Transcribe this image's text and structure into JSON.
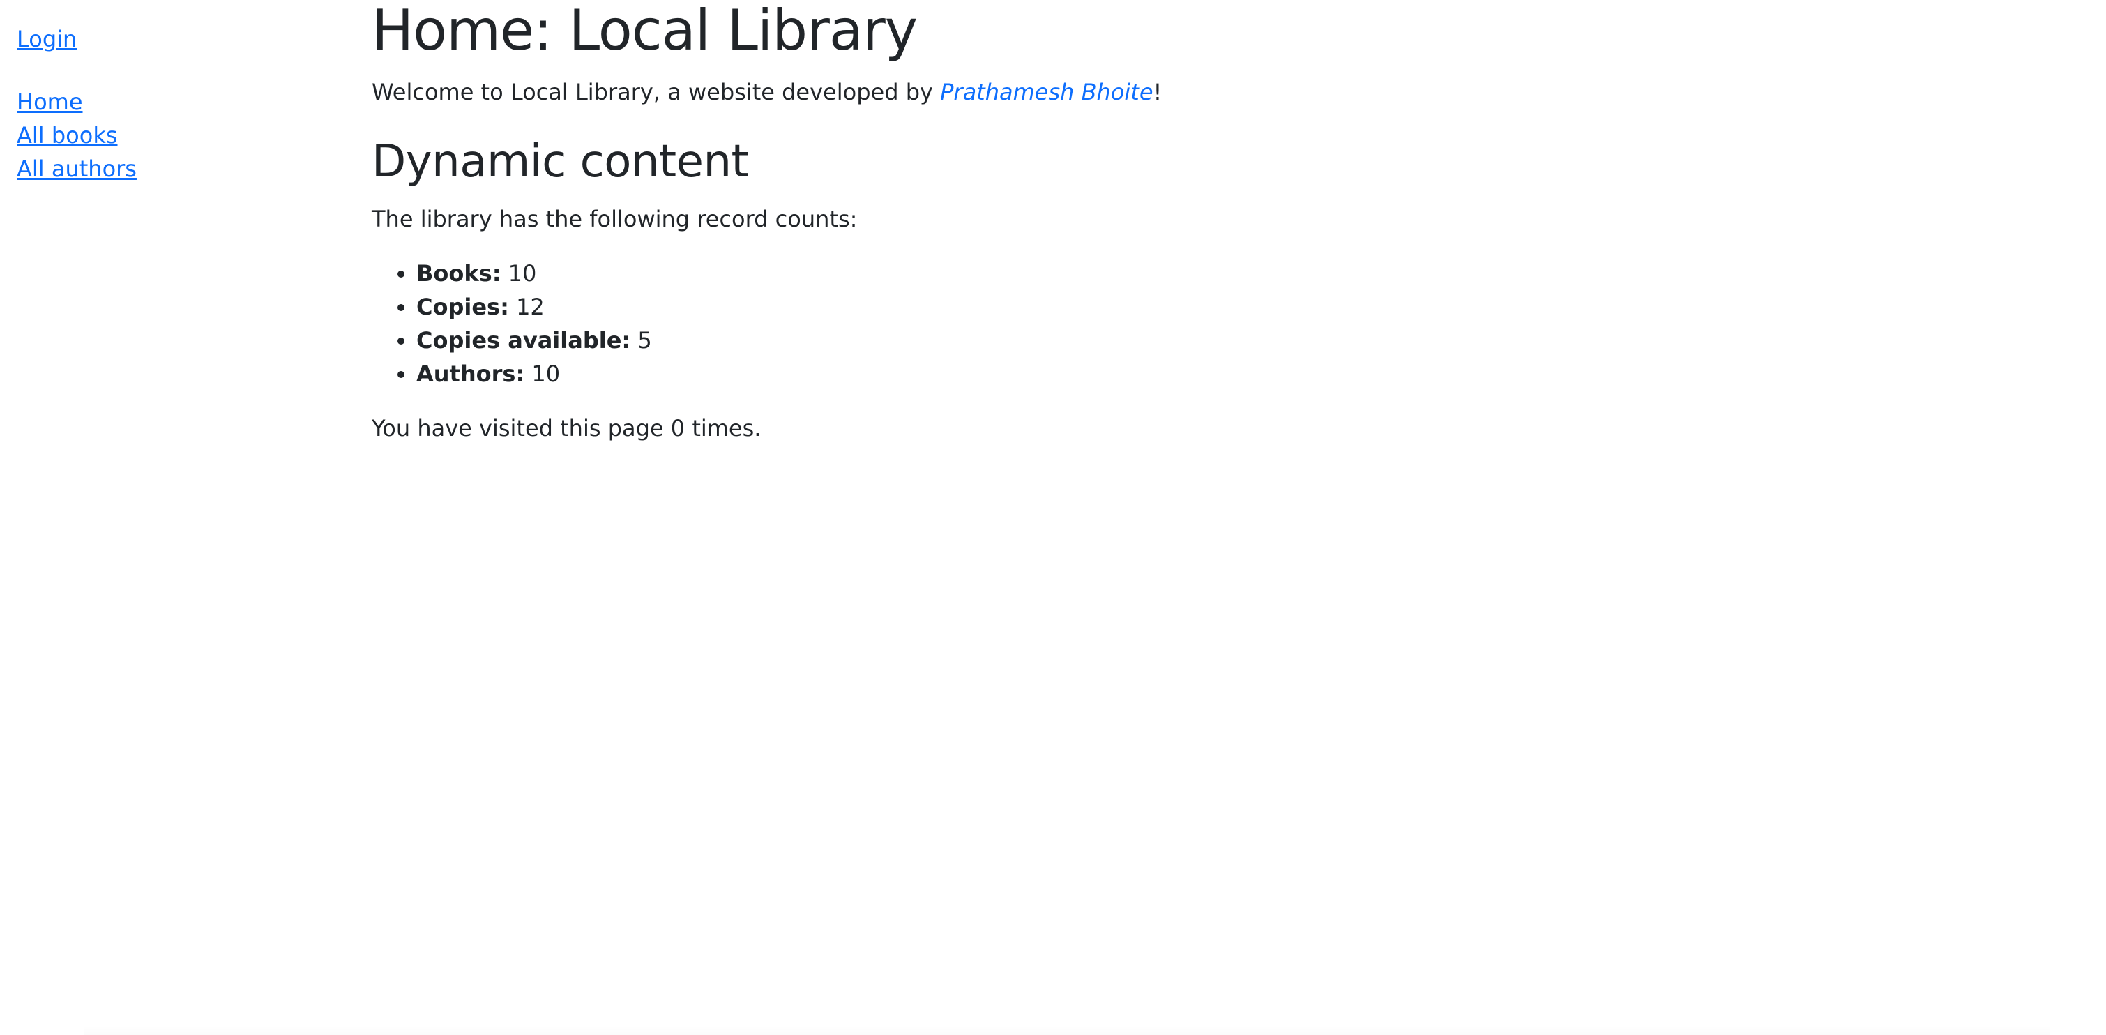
{
  "sidebar": {
    "login_label": "Login",
    "nav": [
      {
        "label": "Home"
      },
      {
        "label": "All books"
      },
      {
        "label": "All authors"
      }
    ]
  },
  "main": {
    "title": "Home: Local Library",
    "welcome": {
      "prefix": "Welcome to Local Library, a website developed by ",
      "author_link": "Prathamesh Bhoite",
      "suffix": "!"
    },
    "section_title": "Dynamic content",
    "counts_intro": "The library has the following record counts:",
    "counts": [
      {
        "label": "Books:",
        "value": "10"
      },
      {
        "label": "Copies:",
        "value": "12"
      },
      {
        "label": "Copies available:",
        "value": "5"
      },
      {
        "label": "Authors:",
        "value": "10"
      }
    ],
    "visits": "You have visited this page 0 times."
  },
  "colors": {
    "text": "#212529",
    "link": "#0d6efd",
    "background": "#ffffff"
  }
}
